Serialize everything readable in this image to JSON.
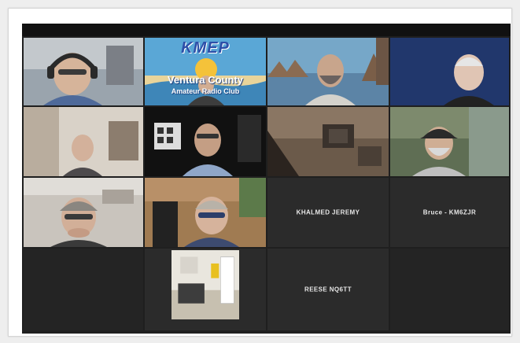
{
  "app": "video-conference-gallery",
  "logo_tile": {
    "logo_text": "KMEP",
    "banner_line1": "Ventura County",
    "banner_line2": "Amateur Radio Club"
  },
  "participants": [
    {
      "id": "p1",
      "name": ""
    },
    {
      "id": "p2",
      "name": ""
    },
    {
      "id": "p3",
      "name": ""
    },
    {
      "id": "p4",
      "name": ""
    },
    {
      "id": "p5",
      "name": ""
    },
    {
      "id": "p6",
      "name": ""
    },
    {
      "id": "p7",
      "name": ""
    },
    {
      "id": "p8",
      "name": ""
    },
    {
      "id": "p9",
      "name": ""
    },
    {
      "id": "p10",
      "name": ""
    },
    {
      "id": "p11",
      "name": "KHALMED JEREMY"
    },
    {
      "id": "p12",
      "name": "Bruce - KM6ZJR"
    },
    {
      "id": "p13",
      "name": ""
    },
    {
      "id": "p14",
      "name": "REESE NQ6TT"
    }
  ],
  "colors": {
    "window_bg": "#1f1f1f",
    "tile_bg": "#2b2b2b",
    "active_speaker": "#c8e27a",
    "name_text": "#e7e7e7"
  }
}
